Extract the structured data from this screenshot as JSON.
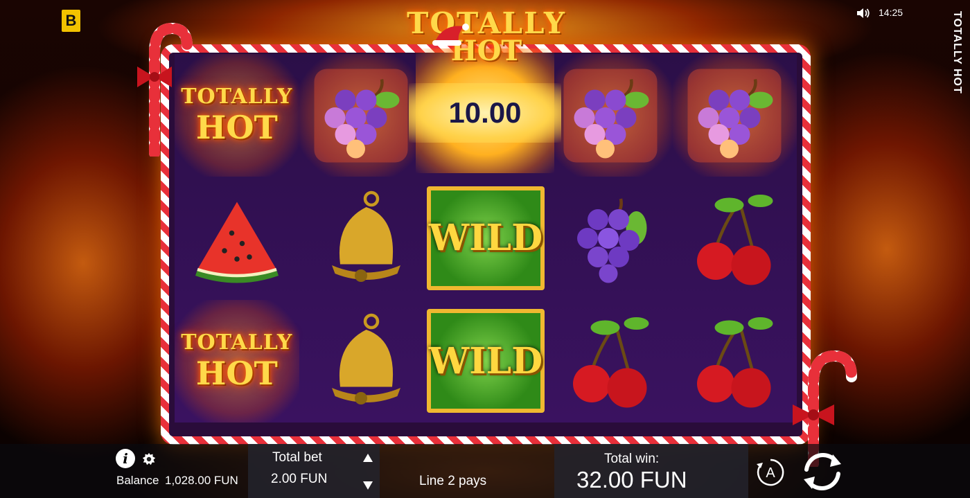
{
  "top_bar": {
    "brand_letter": "B",
    "time": "14:25",
    "side_title": "TOTALLY HOT"
  },
  "game_logo": {
    "line1": "TOTALLY",
    "line2": "HOT"
  },
  "reels": {
    "win_amount": "10.00",
    "wild_label": "WILD",
    "hot_line1": "TOTALLY",
    "hot_line2": "HOT",
    "grid": [
      [
        "totally-hot-symbol",
        "burning-grapes-symbol",
        "win-amount",
        "burning-grapes-symbol",
        "burning-grapes-symbol"
      ],
      [
        "watermelon-symbol",
        "bell-symbol",
        "wild-symbol",
        "grapes-symbol",
        "cherries-symbol"
      ],
      [
        "totally-hot-symbol",
        "bell-symbol",
        "wild-symbol",
        "cherries-symbol",
        "cherries-symbol"
      ]
    ]
  },
  "bottom_bar": {
    "balance_label": "Balance",
    "balance_value": "1,028.00 FUN",
    "total_bet_label": "Total bet",
    "total_bet_value": "2.00 FUN",
    "line_pays": "Line 2 pays",
    "total_win_label": "Total win:",
    "total_win_value": "32.00 FUN",
    "autoplay_letter": "A"
  },
  "colors": {
    "brand_yellow": "#f2c200",
    "frame_red": "#e8303a",
    "reel_purple": "#2b0f48",
    "wild_green": "#2f8a18",
    "gold": "#ffd740"
  }
}
